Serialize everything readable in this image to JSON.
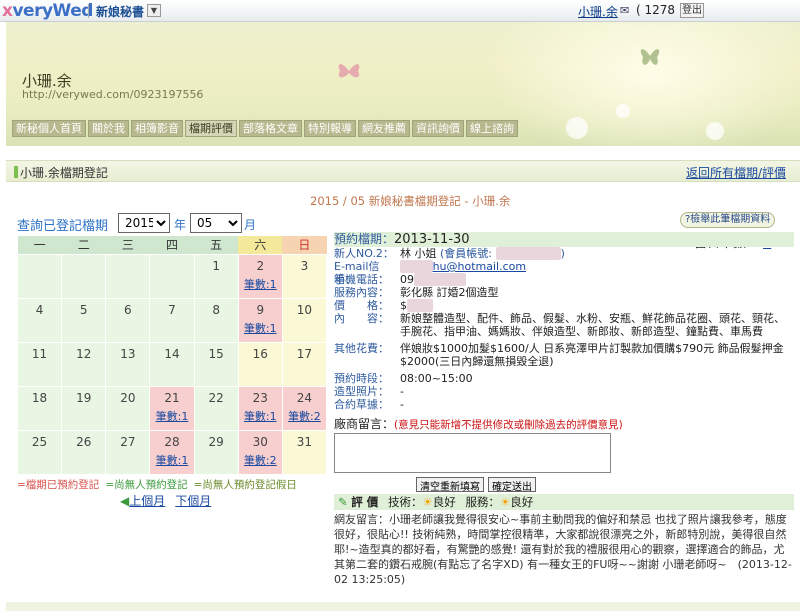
{
  "topbar": {
    "logo_x": "x",
    "logo_text": "veryWed",
    "service": "新娘秘書",
    "dropdown": "▼",
    "user_name": "小珊.余",
    "mail_icon": "✉",
    "mail_count": "( 1278 )",
    "logout": "登出"
  },
  "banner": {
    "title": "小珊.余",
    "url": "http://verywed.com/0923197556"
  },
  "nav": {
    "items": [
      "新秘個人首頁",
      "關於我",
      "相簿影音",
      "檔期評價",
      "部落格文章",
      "特別報導",
      "網友推薦",
      "資訊詢價",
      "線上諮詢"
    ],
    "active_index": 3
  },
  "section": {
    "title": "小珊.余檔期登記",
    "back_link": "返回所有檔期/評價",
    "subtitle": "2015 / 05 新娘秘書檔期登記 - 小珊.余"
  },
  "query": {
    "label": "查詢已登記檔期",
    "year": "2015",
    "year_unit": "年",
    "month": "05",
    "month_unit": "月"
  },
  "calendar": {
    "weekdays": [
      "一",
      "二",
      "三",
      "四",
      "五",
      "六",
      "日"
    ],
    "count_label": "筆數:1",
    "count_label_2": "筆數:2",
    "weeks": [
      [
        "",
        "",
        "",
        "",
        "1",
        "2",
        "3"
      ],
      [
        "4",
        "5",
        "6",
        "7",
        "8",
        "9",
        "10"
      ],
      [
        "11",
        "12",
        "13",
        "14",
        "15",
        "16",
        "17"
      ],
      [
        "18",
        "19",
        "20",
        "21",
        "22",
        "23",
        "24"
      ],
      [
        "25",
        "26",
        "27",
        "28",
        "29",
        "30",
        "31"
      ]
    ]
  },
  "legend": {
    "booked": "=檔期已預約登記",
    "free": "=尚無人預約登記",
    "free_holiday": "=尚無人預約登記假日"
  },
  "pager": {
    "prev": "上個月",
    "next": "下個月"
  },
  "find_button": "?檢舉此筆檔期資料",
  "daycount": {
    "label": "當日筆數：",
    "p1": "1",
    "p2": "2"
  },
  "detail": {
    "date_label": "預約檔期：",
    "date_value": "2013-11-30",
    "bride_label": "新人NO.2：",
    "bride_value": "林  小姐",
    "member_label": "(會員帳號:",
    "email_label": "E-mail信箱：",
    "email_value": "hu@hotmail.com",
    "phone_label": "手機電話：",
    "phone_value": "09",
    "service_label": "服務內容：",
    "service_value": "彰化縣 訂婚2個造型",
    "price_label": "價　　格：",
    "price_value": "$",
    "content_label": "內　　容：",
    "content_value": "新娘整體造型、配件、飾品、假髮、水粉、安瓶、鮮花飾品花圈、頭花、頸花、手腕花、指甲油、媽媽妝、伴娘造型、新郎妝、新郎造型、鐘點費、車馬費",
    "other_label": "其他花費：",
    "other_value": "伴娘妝$1000加髮$1600/人 日系亮澤甲片訂製款加價購$790元 飾品假髮押金$2000(三日內歸還無損毀全退)",
    "time_label": "預約時段：",
    "time_value": "08:00~15:00",
    "photo_label": "造型照片：",
    "photo_value": "-",
    "contract_label": "合約草據：",
    "contract_value": "-"
  },
  "message": {
    "label": "廠商留言：",
    "note": "(意見只能新增不提供修改或刪除過去的評價意見)",
    "clear_btn": "清空重新填寫",
    "submit_btn": "確定送出"
  },
  "evaluation": {
    "label": "評 價",
    "tech_label": "技術：",
    "tech_value": "良好",
    "service_label": "服務：",
    "service_value": "良好",
    "review": "網友留言：小珊老師讓我覺得很安心~事前主動問我的偏好和禁忌 也找了照片讓我參考，態度很好，很貼心!! 技術純熟，時間掌控很精準，大家都說很漂亮之外，新郎特別說，美得很自然耶!~造型真的都好看，有驚艷的感覺! 還有對於我的禮服很用心的觀察，選擇適合的飾品，尤其第二套的鑽石戒腕(有點忘了名字XD) 有一種女王的FU呀~~謝謝 小珊老師呀~　(2013-12-02 13:25:05)"
  },
  "colors": {
    "link": "#1a4aa0",
    "booked": "#f7cfcf",
    "free": "#e9f6e4",
    "holiday": "#fbf8d6"
  }
}
